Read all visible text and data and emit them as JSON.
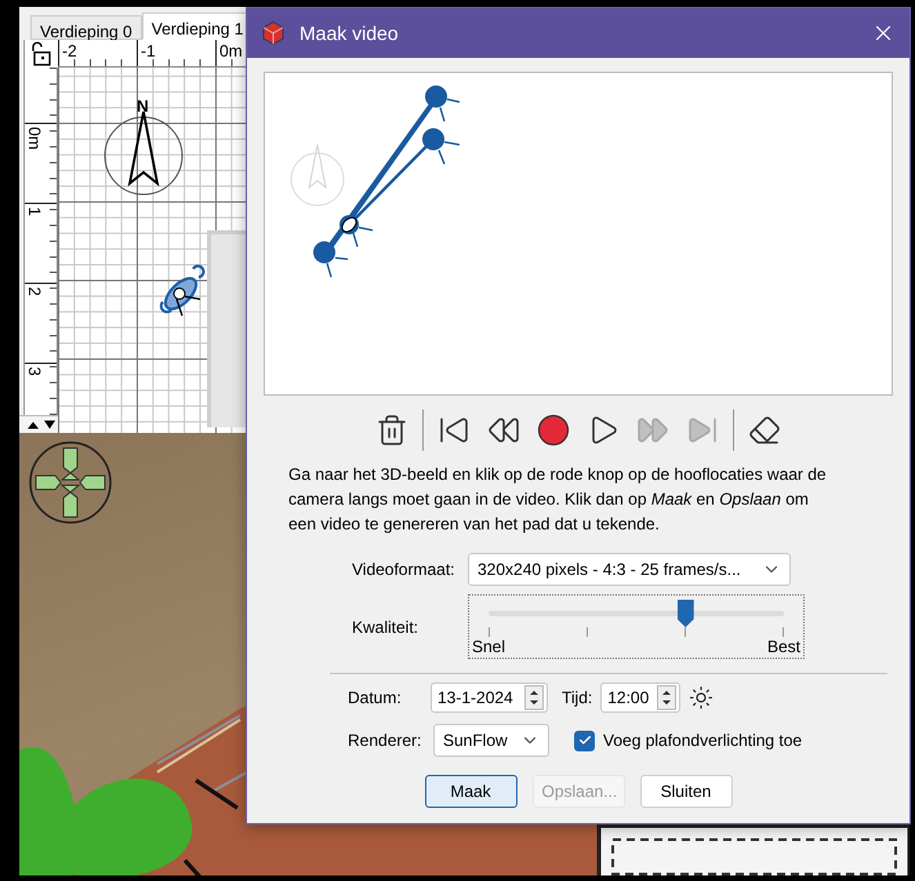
{
  "plan": {
    "tabs": [
      {
        "label": "Verdieping 0",
        "selected": false
      },
      {
        "label": "Verdieping 1",
        "selected": true
      }
    ],
    "x_ruler": [
      "-2",
      "-1",
      "0m"
    ],
    "y_ruler": [
      "0m",
      "1",
      "2",
      "3"
    ],
    "compass_label": "N"
  },
  "dialog": {
    "title": "Maak video",
    "toolbar": [
      [
        {
          "kind": "trash",
          "disabled": false
        }
      ],
      [
        {
          "kind": "skip-start",
          "disabled": false
        },
        {
          "kind": "rewind",
          "disabled": false
        },
        {
          "kind": "record",
          "disabled": false
        },
        {
          "kind": "play",
          "disabled": false
        },
        {
          "kind": "fast-forward",
          "disabled": true
        },
        {
          "kind": "skip-end",
          "disabled": true
        }
      ],
      [
        {
          "kind": "eraser",
          "disabled": false
        }
      ]
    ],
    "instructions": "Ga naar het 3D-beeld en klik op de rode knop op de hooflocaties waar de camera langs moet gaan in de video. Klik dan op *Maak* en *Opslaan* om een video te genereren van het pad dat u tekende.",
    "video_format": {
      "label": "Videoformaat:",
      "value": "320x240 pixels - 4:3 - 25 frames/s..."
    },
    "quality": {
      "label": "Kwaliteit:",
      "level": 0.667,
      "min_label": "Snel",
      "max_label": "Best"
    },
    "date": {
      "label": "Datum:",
      "value": "13-1-2024"
    },
    "time": {
      "label": "Tijd:",
      "value": "12:00"
    },
    "renderer": {
      "label": "Renderer:",
      "value": "SunFlow"
    },
    "ceiling_light": {
      "label": "Voeg plafondverlichting toe",
      "checked": true
    },
    "buttons": [
      {
        "label": "Maak",
        "default": true,
        "disabled": false
      },
      {
        "label": "Opslaan...",
        "default": false,
        "disabled": true
      },
      {
        "label": "Sluiten",
        "default": false,
        "disabled": false
      }
    ]
  }
}
